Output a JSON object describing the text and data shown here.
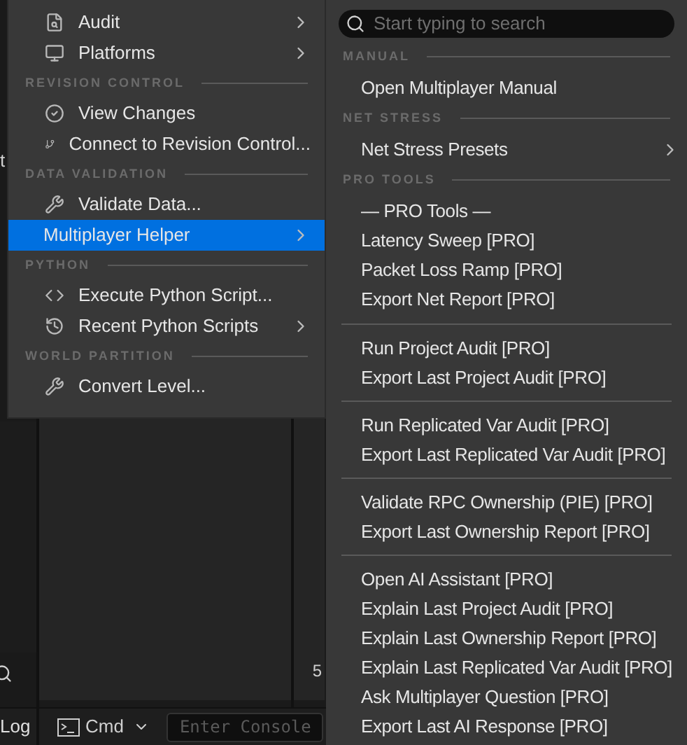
{
  "background": {
    "left_fragment": "t",
    "row_number": "5",
    "log_tab": "Log",
    "cmd_button": "Cmd",
    "console_field": {
      "placeholder": "Enter Console"
    }
  },
  "main_menu": {
    "sections": [
      {
        "items": [
          {
            "label": "Audit",
            "has_submenu": true,
            "selected": false
          },
          {
            "label": "Platforms",
            "has_submenu": true,
            "selected": false
          }
        ]
      },
      {
        "header": "REVISION CONTROL",
        "items": [
          {
            "label": "View Changes",
            "has_submenu": false,
            "selected": false
          },
          {
            "label": "Connect to Revision Control...",
            "has_submenu": false,
            "selected": false
          }
        ]
      },
      {
        "header": "DATA VALIDATION",
        "items": [
          {
            "label": "Validate Data...",
            "has_submenu": false,
            "selected": false
          },
          {
            "label": "Multiplayer Helper",
            "has_submenu": true,
            "selected": true
          }
        ]
      },
      {
        "header": "PYTHON",
        "items": [
          {
            "label": "Execute Python Script...",
            "has_submenu": false,
            "selected": false
          },
          {
            "label": "Recent Python Scripts",
            "has_submenu": true,
            "selected": false
          }
        ]
      },
      {
        "header": "WORLD PARTITION",
        "items": [
          {
            "label": "Convert Level...",
            "has_submenu": false,
            "selected": false
          }
        ]
      }
    ]
  },
  "submenu": {
    "search": {
      "placeholder": "Start typing to search"
    },
    "sections": [
      {
        "header": "MANUAL",
        "groups": [
          [
            {
              "label": "Open Multiplayer Manual",
              "has_submenu": false
            }
          ]
        ]
      },
      {
        "header": "NET STRESS",
        "groups": [
          [
            {
              "label": "Net Stress Presets",
              "has_submenu": true
            }
          ]
        ]
      },
      {
        "header": "PRO TOOLS",
        "groups": [
          [
            {
              "label": "— PRO Tools —",
              "has_submenu": false
            },
            {
              "label": "Latency Sweep [PRO]",
              "has_submenu": false
            },
            {
              "label": "Packet Loss Ramp [PRO]",
              "has_submenu": false
            },
            {
              "label": "Export Net Report [PRO]",
              "has_submenu": false
            }
          ],
          [
            {
              "label": "Run Project Audit [PRO]",
              "has_submenu": false
            },
            {
              "label": "Export Last Project Audit [PRO]",
              "has_submenu": false
            }
          ],
          [
            {
              "label": "Run Replicated Var Audit [PRO]",
              "has_submenu": false
            },
            {
              "label": "Export Last Replicated Var Audit [PRO]",
              "has_submenu": false
            }
          ],
          [
            {
              "label": "Validate RPC Ownership (PIE) [PRO]",
              "has_submenu": false
            },
            {
              "label": "Export Last Ownership Report [PRO]",
              "has_submenu": false
            }
          ],
          [
            {
              "label": "Open AI Assistant [PRO]",
              "has_submenu": false
            },
            {
              "label": "Explain Last Project Audit [PRO]",
              "has_submenu": false
            },
            {
              "label": "Explain Last Ownership Report [PRO]",
              "has_submenu": false
            },
            {
              "label": "Explain Last Replicated Var Audit [PRO]",
              "has_submenu": false
            },
            {
              "label": "Ask Multiplayer Question [PRO]",
              "has_submenu": false
            },
            {
              "label": "Export Last AI Response [PRO]",
              "has_submenu": false
            }
          ]
        ]
      }
    ]
  }
}
